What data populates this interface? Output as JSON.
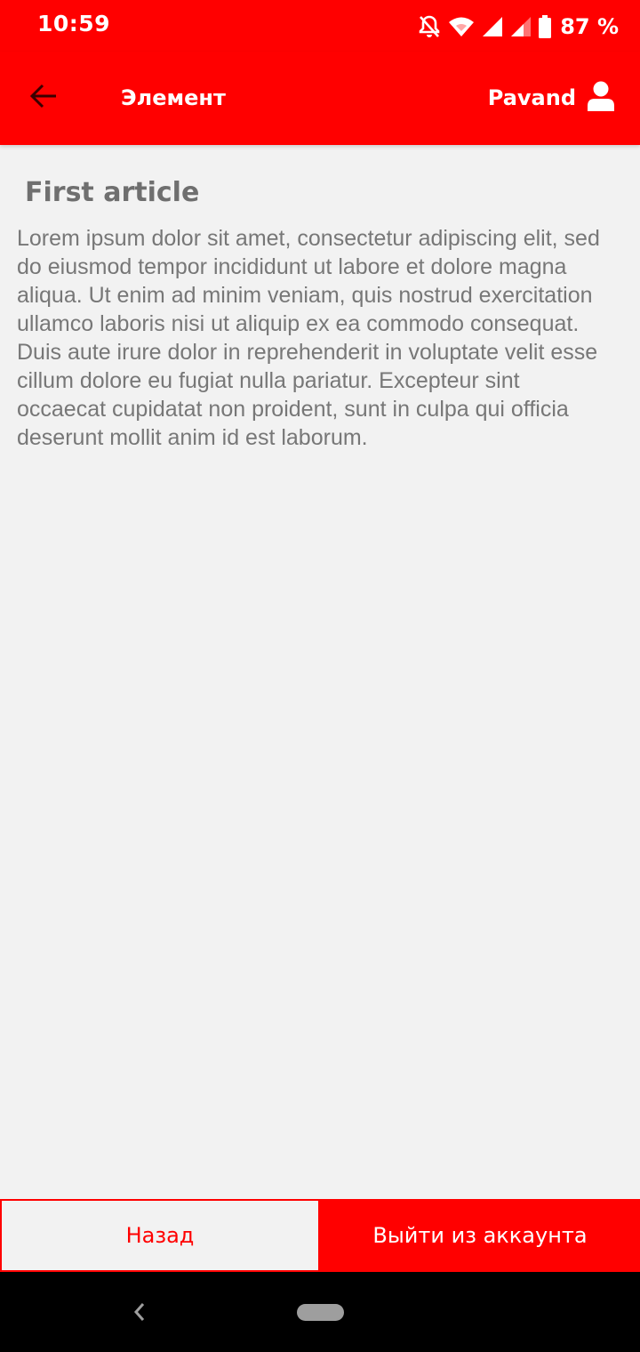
{
  "status_bar": {
    "time": "10:59",
    "battery": "87 %",
    "icons": [
      "bell-off-icon",
      "wifi-icon",
      "signal-icon",
      "signal-icon",
      "battery-icon"
    ]
  },
  "app_bar": {
    "title": "Элемент",
    "user_name": "Pavand",
    "back_icon": "arrow-left-icon",
    "user_icon": "person-icon"
  },
  "article": {
    "title": "First article",
    "body": "Lorem ipsum dolor sit amet, consectetur adipiscing elit, sed do eiusmod tempor incididunt ut labore et dolore magna aliqua. Ut enim ad minim veniam, quis nostrud exercitation ullamco laboris nisi ut aliquip ex ea commodo consequat. Duis aute irure dolor in reprehenderit in voluptate velit esse cillum dolore eu fugiat nulla pariatur. Excepteur sint occaecat cupidatat non proident, sunt in culpa qui officia deserunt mollit anim id est laborum."
  },
  "buttons": {
    "back_label": "Назад",
    "logout_label": "Выйти из аккаунта"
  },
  "colors": {
    "accent": "#ff0000",
    "background": "#f2f2f2",
    "text_muted": "#777777"
  }
}
